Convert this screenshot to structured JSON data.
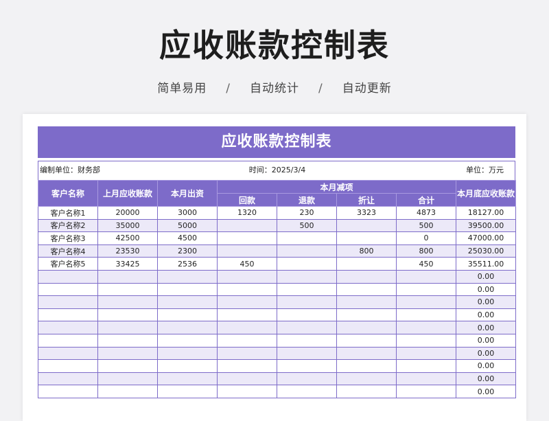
{
  "hero": {
    "title": "应收账款控制表",
    "tags": [
      "简单易用",
      "自动统计",
      "自动更新"
    ],
    "separator": "/"
  },
  "sheet": {
    "title": "应收账款控制表",
    "meta": {
      "unit_label": "编制单位：财务部",
      "time_label": "时间：2025/3/4",
      "currency_label": "单位：万元"
    },
    "headers": {
      "customer": "客户名称",
      "prev_receivable": "上月应收账款",
      "month_shipment": "本月出资",
      "reductions": "本月减项",
      "returned": "回款",
      "refund": "退款",
      "discount": "折让",
      "subtotal": "合计",
      "month_end_receivable": "本月底应收账款"
    },
    "rows": [
      {
        "customer": "客户名称1",
        "prev": "20000",
        "ship": "3000",
        "returned": "1320",
        "refund": "230",
        "discount": "3323",
        "subtotal": "4873",
        "end": "18127.00"
      },
      {
        "customer": "客户名称2",
        "prev": "35000",
        "ship": "5000",
        "returned": "",
        "refund": "500",
        "discount": "",
        "subtotal": "500",
        "end": "39500.00"
      },
      {
        "customer": "客户名称3",
        "prev": "42500",
        "ship": "4500",
        "returned": "",
        "refund": "",
        "discount": "",
        "subtotal": "0",
        "end": "47000.00"
      },
      {
        "customer": "客户名称4",
        "prev": "23530",
        "ship": "2300",
        "returned": "",
        "refund": "",
        "discount": "800",
        "subtotal": "800",
        "end": "25030.00"
      },
      {
        "customer": "客户名称5",
        "prev": "33425",
        "ship": "2536",
        "returned": "450",
        "refund": "",
        "discount": "",
        "subtotal": "450",
        "end": "35511.00"
      },
      {
        "customer": "",
        "prev": "",
        "ship": "",
        "returned": "",
        "refund": "",
        "discount": "",
        "subtotal": "",
        "end": "0.00"
      },
      {
        "customer": "",
        "prev": "",
        "ship": "",
        "returned": "",
        "refund": "",
        "discount": "",
        "subtotal": "",
        "end": "0.00"
      },
      {
        "customer": "",
        "prev": "",
        "ship": "",
        "returned": "",
        "refund": "",
        "discount": "",
        "subtotal": "",
        "end": "0.00"
      },
      {
        "customer": "",
        "prev": "",
        "ship": "",
        "returned": "",
        "refund": "",
        "discount": "",
        "subtotal": "",
        "end": "0.00"
      },
      {
        "customer": "",
        "prev": "",
        "ship": "",
        "returned": "",
        "refund": "",
        "discount": "",
        "subtotal": "",
        "end": "0.00"
      },
      {
        "customer": "",
        "prev": "",
        "ship": "",
        "returned": "",
        "refund": "",
        "discount": "",
        "subtotal": "",
        "end": "0.00"
      },
      {
        "customer": "",
        "prev": "",
        "ship": "",
        "returned": "",
        "refund": "",
        "discount": "",
        "subtotal": "",
        "end": "0.00"
      },
      {
        "customer": "",
        "prev": "",
        "ship": "",
        "returned": "",
        "refund": "",
        "discount": "",
        "subtotal": "",
        "end": "0.00"
      },
      {
        "customer": "",
        "prev": "",
        "ship": "",
        "returned": "",
        "refund": "",
        "discount": "",
        "subtotal": "",
        "end": "0.00"
      },
      {
        "customer": "",
        "prev": "",
        "ship": "",
        "returned": "",
        "refund": "",
        "discount": "",
        "subtotal": "",
        "end": "0.00"
      }
    ]
  }
}
